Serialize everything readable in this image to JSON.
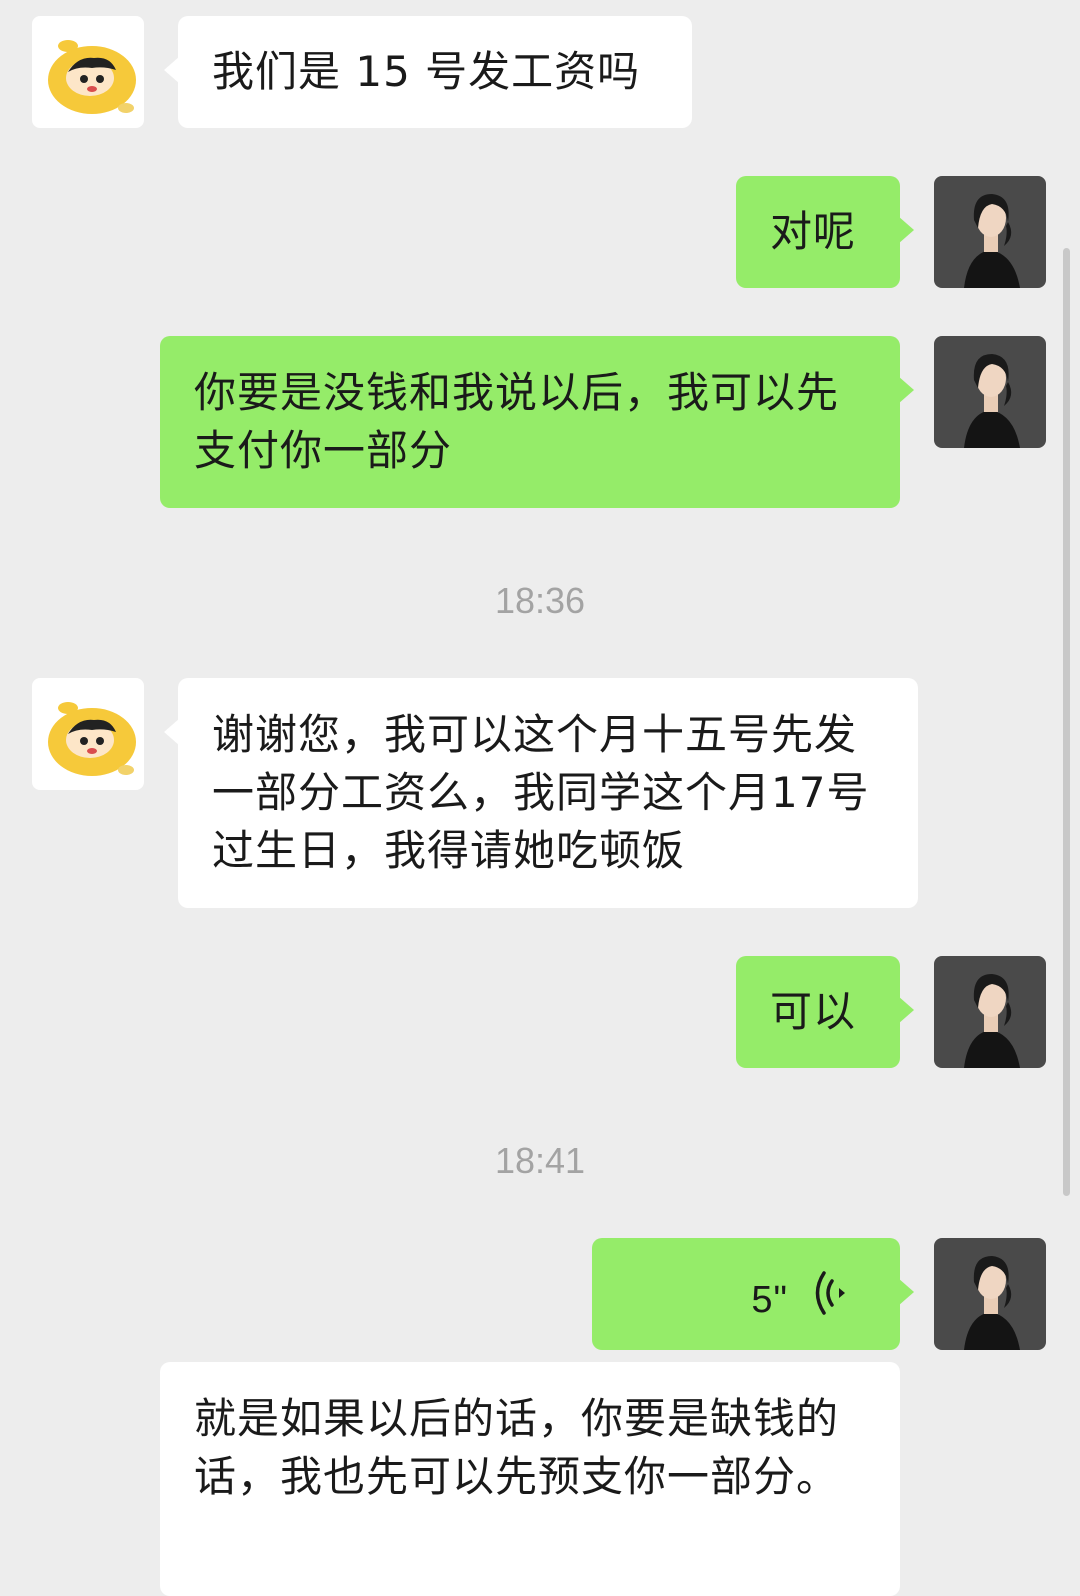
{
  "messages": [
    {
      "text": "我们是 15 号发工资吗"
    },
    {
      "text": "对呢"
    },
    {
      "text": "你要是没钱和我说以后，我可以先支付你一部分"
    },
    {
      "text": "谢谢您，我可以这个月十五号先发一部分工资么，我同学这个月17号过生日，我得请她吃顿饭"
    },
    {
      "text": "可以"
    },
    {
      "duration": "5\""
    },
    {
      "text": "就是如果以后的话，你要是缺钱的话，我也先可以先预支你一部分。"
    }
  ],
  "timestamps": [
    "18:36",
    "18:41"
  ],
  "icons": {
    "contact_avatar": "cartoon-boy-avatar",
    "self_avatar": "woman-photo-avatar",
    "voice": "voice-wave-icon"
  },
  "colors": {
    "background": "#ededed",
    "incoming_bubble": "#ffffff",
    "outgoing_bubble": "#95ec69",
    "timestamp_text": "#a3a3a3"
  }
}
